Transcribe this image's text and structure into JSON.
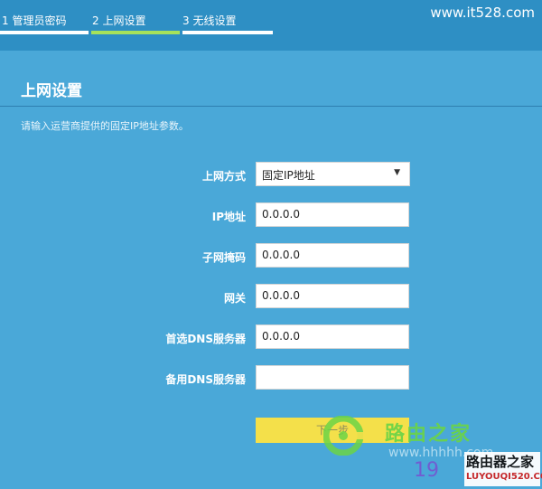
{
  "header": {
    "steps": [
      {
        "label": "1 管理员密码",
        "state": "done"
      },
      {
        "label": "2 上网设置",
        "state": "active"
      },
      {
        "label": "3 无线设置",
        "state": "pending"
      }
    ],
    "site_url": "www.it528.com"
  },
  "page": {
    "title": "上网设置",
    "hint": "请输入运营商提供的固定IP地址参数。"
  },
  "form": {
    "connection_type": {
      "label": "上网方式",
      "value": "固定IP地址",
      "arrow": "▼"
    },
    "ip": {
      "label": "IP地址",
      "value": "0.0.0.0"
    },
    "subnet": {
      "label": "子网掩码",
      "value": "0.0.0.0"
    },
    "gateway": {
      "label": "网关",
      "value": "0.0.0.0"
    },
    "dns_primary": {
      "label": "首选DNS服务器",
      "value": "0.0.0.0"
    },
    "dns_secondary": {
      "label": "备用DNS服务器",
      "value": ""
    },
    "next_label": "下一步"
  },
  "watermark": {
    "name": "路由之家",
    "url": "www.hhhhh.com",
    "number": "19",
    "box_title": "路由器之家",
    "box_sub": "LUYOUQI520.COM"
  },
  "colors": {
    "background": "#4aa8d8",
    "topbar": "#2e8fc4",
    "active_step": "#a6e25a",
    "next_button": "#f4e04a"
  }
}
